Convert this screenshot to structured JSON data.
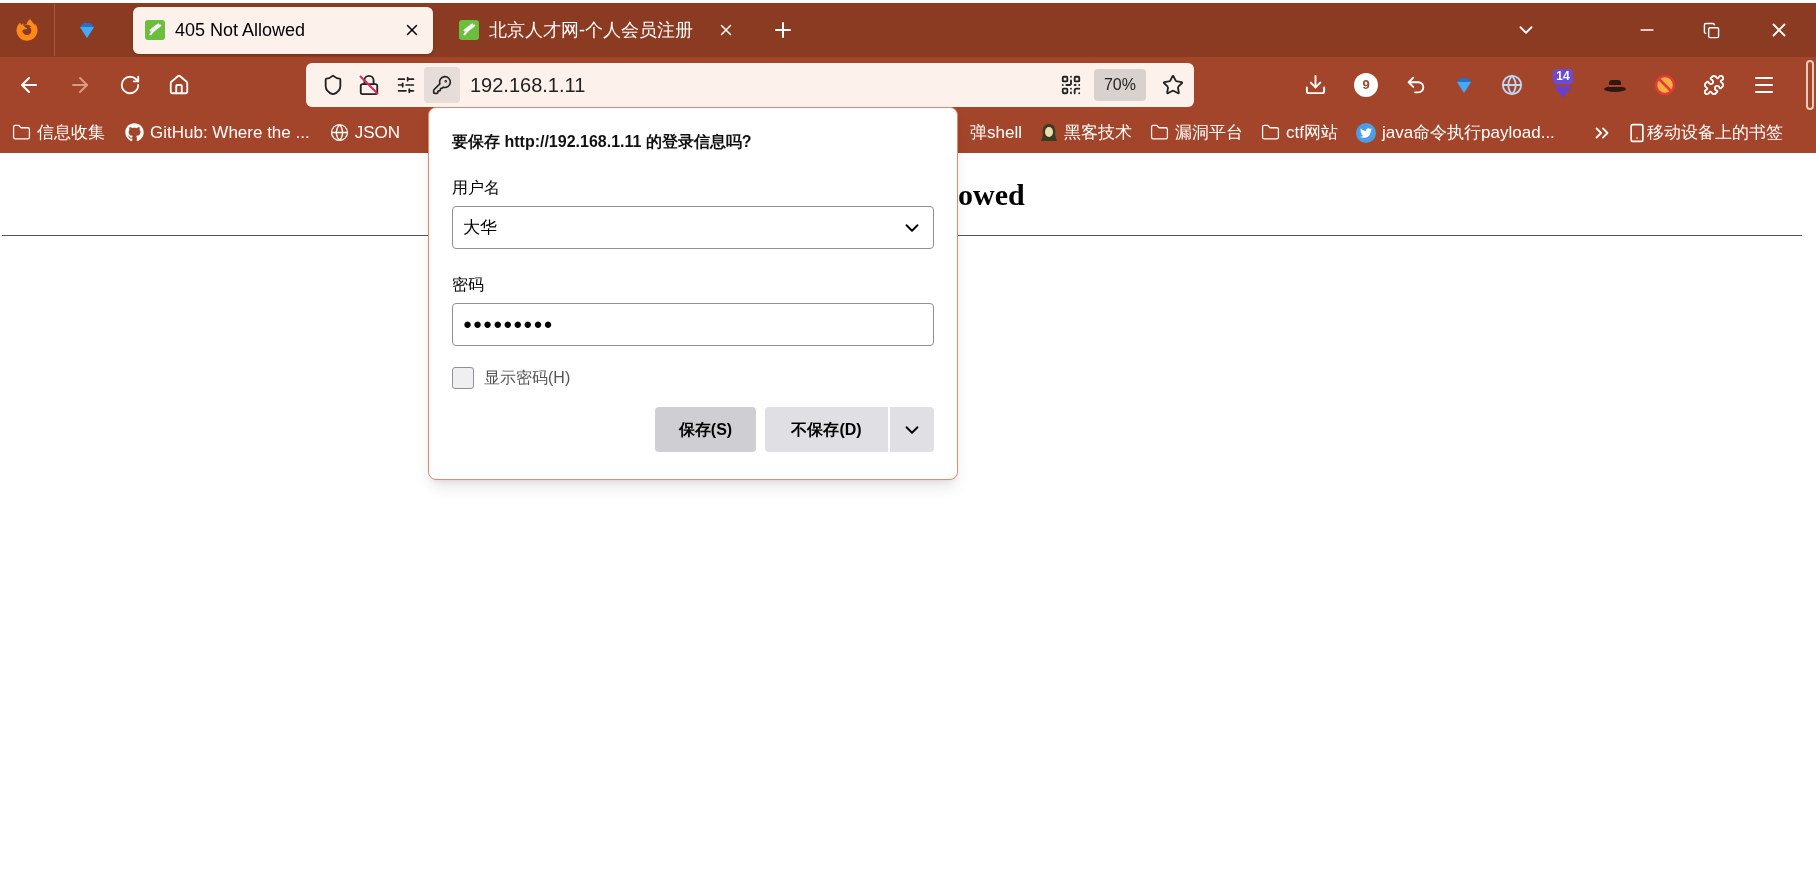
{
  "tabs": [
    {
      "label": "405 Not Allowed",
      "selected": true
    },
    {
      "label": "北京人才网-个人会员注册",
      "selected": false
    }
  ],
  "toolbar": {
    "url": "192.168.1.11",
    "zoom": "70%",
    "extension_badges": [
      "9",
      "14"
    ]
  },
  "bookmarks": [
    {
      "label": "信息收集",
      "kind": "folder"
    },
    {
      "label": "GitHub: Where the ...",
      "kind": "github"
    },
    {
      "label": "JSON",
      "kind": "globe"
    },
    {
      "label": "弹shell",
      "kind": "plain"
    },
    {
      "label": "黑客技术",
      "kind": "avatar"
    },
    {
      "label": "漏洞平台",
      "kind": "folder"
    },
    {
      "label": "ctf网站",
      "kind": "folder"
    },
    {
      "label": "java命令执行payload...",
      "kind": "bird"
    }
  ],
  "mobile_bookmarks": "移动设备上的书签",
  "page": {
    "heading": "owed"
  },
  "dialog": {
    "title": "要保存 http://192.168.1.11 的登录信息吗?",
    "username_label": "用户名",
    "username": "大华",
    "password_label": "密码",
    "password": "●●●●●●●●●",
    "show_password": {
      "label": "显示密码(H)",
      "checked": false
    },
    "buttons": [
      {
        "label": "保存(S)",
        "kind": "primary"
      },
      {
        "label": "不保存(D)",
        "kind": "split"
      }
    ]
  }
}
